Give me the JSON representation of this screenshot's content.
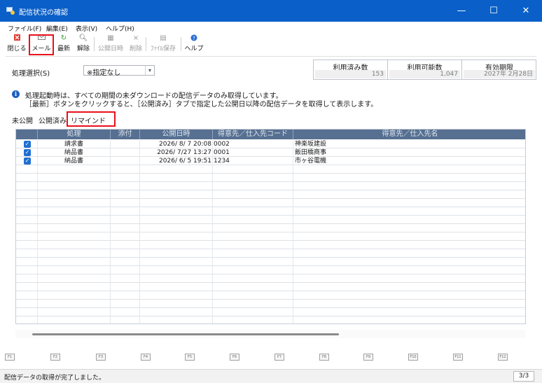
{
  "window": {
    "title": "配信状況の確認",
    "minimize": "—",
    "maximize": "☐",
    "close": "✕"
  },
  "menu": [
    "ファイル(F)",
    "編集(E)",
    "表示(V)",
    "ヘルプ(H)"
  ],
  "toolbar": {
    "close": "閉じる",
    "mail": "メール",
    "refresh": "最新",
    "cancel": "解除",
    "publish_date": "公開日時",
    "delete": "削除",
    "save_file": "ﾌｧｲﾙ保存",
    "help": "ヘルプ"
  },
  "process": {
    "label": "処理選択(S)",
    "value": "※指定なし"
  },
  "stats": [
    {
      "label": "利用済み数",
      "value": "153"
    },
    {
      "label": "利用可能数",
      "value": "1,047"
    },
    {
      "label": "有効期限",
      "value": "2027年 2月28日"
    }
  ],
  "info": {
    "line1": "処理起動時は、すべての期間の未ダウンロードの配信データのみ取得しています。",
    "line2": "［最新］ボタンをクリックすると、［公開済み］タブで指定した公開日以降の配信データを取得して表示します。"
  },
  "tabs": {
    "unpublished": "未公開",
    "published": "公開済み",
    "reminder": "リマインド"
  },
  "grid": {
    "columns": [
      "処理",
      "添付",
      "公開日時",
      "得意先／仕入先コード",
      "得意先／仕入先名"
    ],
    "rows": [
      {
        "checked": true,
        "process": "請求書",
        "attach": "",
        "date": "2026/ 8/ 7 20:08",
        "code": "0002",
        "name": "神楽坂建設"
      },
      {
        "checked": true,
        "process": "納品書",
        "attach": "",
        "date": "2026/ 7/27 13:27",
        "code": "0001",
        "name": "飯田橋商事"
      },
      {
        "checked": true,
        "process": "納品書",
        "attach": "",
        "date": "2026/ 6/ 5 19:51",
        "code": "1234",
        "name": "市ヶ谷電機"
      }
    ]
  },
  "fkeys": [
    "F1",
    "F2",
    "F3",
    "F4",
    "F5",
    "F6",
    "F7",
    "F8",
    "F9",
    "F10",
    "F11",
    "F12"
  ],
  "status": {
    "message": "配信データの取得が完了しました。",
    "page": "3/3"
  }
}
